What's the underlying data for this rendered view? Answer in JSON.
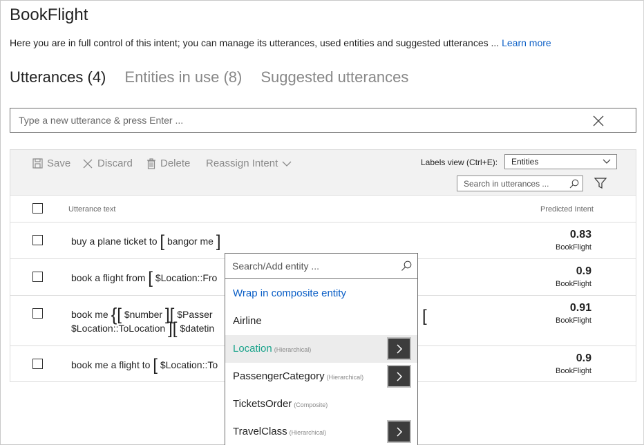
{
  "page": {
    "title": "BookFlight",
    "description": "Here you are in full control of this intent; you can manage its utterances, used entities and suggested utterances ...",
    "learn_more": "Learn more"
  },
  "tabs": [
    {
      "label": "Utterances (4)",
      "active": true
    },
    {
      "label": "Entities in use (8)",
      "active": false
    },
    {
      "label": "Suggested utterances",
      "active": false
    }
  ],
  "new_utterance": {
    "placeholder": "Type a new utterance & press Enter ...",
    "value": ""
  },
  "toolbar": {
    "save": "Save",
    "discard": "Discard",
    "delete": "Delete",
    "reassign": "Reassign Intent",
    "labels_view_label": "Labels view (Ctrl+E):",
    "labels_view_value": "Entities",
    "search_placeholder": "Search in utterances ..."
  },
  "table": {
    "col_utterance": "Utterance text",
    "col_predicted": "Predicted Intent",
    "rows": [
      {
        "line1_pre": "buy a plane ticket to",
        "line1_entity": "bangor me",
        "score": "0.83",
        "intent": "BookFlight"
      },
      {
        "line1_pre": "book a flight from",
        "line1_entity": "$Location::Fro",
        "score": "0.9",
        "intent": "BookFlight"
      },
      {
        "line1_pre": "book me",
        "line1_e1": "$number",
        "line1_e2": "$Passer",
        "line2_e1": "$Location::ToLocation",
        "line2_e2": "$datetin",
        "score": "0.91",
        "intent": "BookFlight"
      },
      {
        "line1_pre": "book me a flight to",
        "line1_entity": "$Location::To",
        "score": "0.9",
        "intent": "BookFlight"
      }
    ]
  },
  "entity_popup": {
    "search_placeholder": "Search/Add entity ...",
    "wrap": "Wrap in composite entity",
    "items": [
      {
        "name": "Airline",
        "sub": "",
        "has_arrow": false,
        "selected": false
      },
      {
        "name": "Location",
        "sub": "(Hierarchical)",
        "has_arrow": true,
        "selected": true
      },
      {
        "name": "PassengerCategory",
        "sub": "(Hierarchical)",
        "has_arrow": true,
        "selected": false
      },
      {
        "name": "TicketsOrder",
        "sub": "(Composite)",
        "has_arrow": false,
        "selected": false
      },
      {
        "name": "TravelClass",
        "sub": "(Hierarchical)",
        "has_arrow": true,
        "selected": false
      }
    ]
  },
  "colors": {
    "link": "#0a5ec6",
    "selected_entity": "#1aa38b",
    "toolbar_bg": "#f2f2f2",
    "arrow_button": "#3c3c3c"
  }
}
